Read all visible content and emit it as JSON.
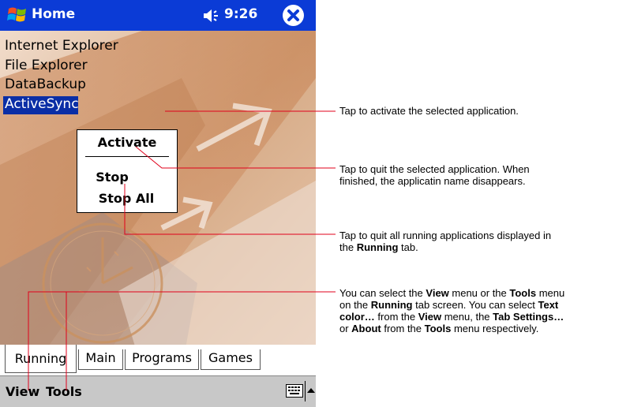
{
  "titlebar": {
    "title": "Home",
    "time": "9:26",
    "start_icon": "windows-flag-icon",
    "volume_icon": "speaker-icon",
    "close_icon": "close-icon",
    "color": "#0b3bd6"
  },
  "running_apps": [
    {
      "label": "Internet Explorer",
      "selected": false
    },
    {
      "label": "File Explorer",
      "selected": false
    },
    {
      "label": "DataBackup",
      "selected": false
    },
    {
      "label": "ActiveSync",
      "selected": true
    }
  ],
  "context_menu": {
    "activate": "Activate",
    "stop": "Stop",
    "stop_all": "Stop All"
  },
  "tabs": [
    {
      "label": "Running",
      "active": true
    },
    {
      "label": "Main",
      "active": false
    },
    {
      "label": "Programs",
      "active": false
    },
    {
      "label": "Games",
      "active": false
    }
  ],
  "menubar": {
    "view": "View",
    "tools": "Tools",
    "keyboard_icon": "keyboard-icon",
    "sip_arrow_icon": "up-arrow-icon"
  },
  "annotations": {
    "activate": "Tap to activate the selected application.",
    "stop": {
      "line1": "Tap to quit the selected application. When",
      "line2": "finished, the applicatin name disappears."
    },
    "stop_all": {
      "line1": "Tap to quit all running applications displayed in",
      "line2_pre": "the ",
      "line2_bold": "Running",
      "line2_post": " tab."
    },
    "menus": {
      "l1_a": "You can select the ",
      "l1_b": "View",
      "l1_c": " menu or the ",
      "l1_d": "Tools",
      "l1_e": " menu",
      "l2_a": "on the ",
      "l2_b": "Running",
      "l2_c": " tab screen. You can select ",
      "l2_d": "Text",
      "l3_a": "color…",
      "l3_b": " from the ",
      "l3_c": "View",
      "l3_d": " menu, the ",
      "l3_e": "Tab Settings…",
      "l4_a": "or ",
      "l4_b": "About",
      "l4_c": " from the ",
      "l4_d": "Tools",
      "l4_e": " menu respectively."
    }
  },
  "colors": {
    "selection": "#0a2ea6",
    "callout_line": "#e0001b",
    "menubar": "#c8c8c8"
  }
}
